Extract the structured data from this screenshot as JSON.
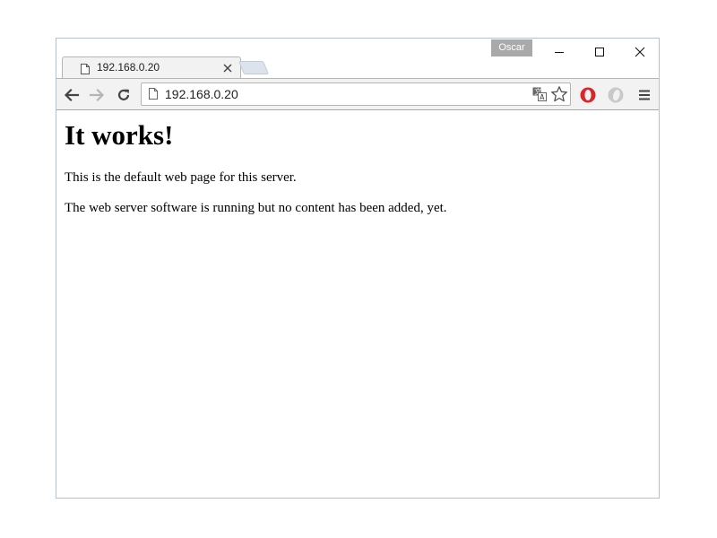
{
  "window": {
    "profile_name": "Oscar",
    "controls": {
      "minimize_icon": "minimize-icon",
      "maximize_icon": "maximize-icon",
      "close_icon": "close-icon"
    }
  },
  "tabs": [
    {
      "title": "192.168.0.20",
      "icon": "page-icon",
      "active": true
    }
  ],
  "toolbar": {
    "url": "192.168.0.20",
    "icons": [
      "back-arrow-icon",
      "forward-arrow-icon",
      "reload-icon",
      "translate-icon",
      "star-icon",
      "opera-extension-icon",
      "extension-icon",
      "menu-icon"
    ]
  },
  "page": {
    "heading": "It works!",
    "paragraphs": [
      "This is the default web page for this server.",
      "The web server software is running but no content has been added, yet."
    ]
  },
  "colors": {
    "toolbar_bg": "#f2f2f2",
    "profile_badge": "#a9a9a9",
    "opera_red": "#d8262c"
  }
}
